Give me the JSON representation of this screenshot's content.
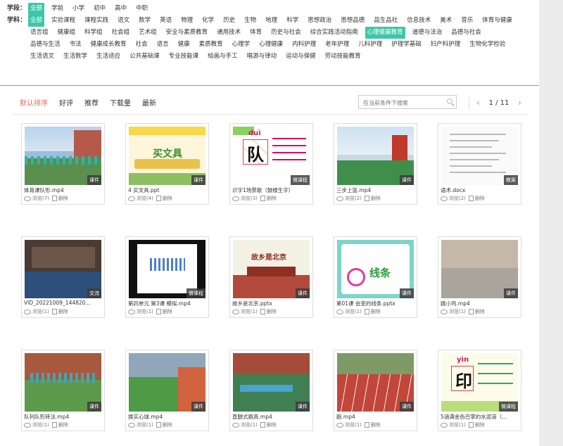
{
  "filters": {
    "stage_label": "学段：",
    "stages": [
      "全部",
      "学前",
      "小学",
      "初中",
      "高中",
      "中职"
    ],
    "stage_active": 0,
    "subject_label": "学科：",
    "subjects": [
      "全部",
      "实验课程",
      "课程实践",
      "语文",
      "数学",
      "英语",
      "物理",
      "化学",
      "历史",
      "生物",
      "地理",
      "科学",
      "思想政治",
      "思想品德",
      "品生品社",
      "信息技术",
      "美术",
      "音乐",
      "体育与健康",
      "语言组",
      "健康组",
      "科学组",
      "社会组",
      "艺术组",
      "安全与素质教育",
      "通用技术",
      "体育",
      "历史与社会",
      "综合实践活动指南",
      "心理健康教育",
      "道德与法治",
      "品德与社会",
      "品德与生活",
      "书法",
      "健康成长教育",
      "社会",
      "语言",
      "健康",
      "素质教育",
      "心理学",
      "心理健康",
      "内科护理",
      "老年护理",
      "儿科护理",
      "护理学基础",
      "妇产科护理",
      "生物化学检验",
      "生活语文",
      "生活数学",
      "生活适应",
      "公共基础课",
      "专业技能课",
      "绘画与手工",
      "唱游与律动",
      "运动与保健",
      "劳动技能教育"
    ],
    "subject_active": [
      0,
      29
    ]
  },
  "sortbar": {
    "sorts": [
      "默认排序",
      "好评",
      "推荐",
      "下载量",
      "最新"
    ],
    "sort_active": 0,
    "search_placeholder": "在当前条件下搜索",
    "page_text": "1 / 11",
    "prev": "‹",
    "next": "›"
  },
  "cards": [
    {
      "title": "体育课队形.mp4",
      "badge": "课件",
      "views": "浏览(7)",
      "del": "删除",
      "thumb": "playground"
    },
    {
      "title": "4 买文具.ppt",
      "badge": "课件",
      "views": "浏览(4)",
      "del": "删除",
      "thumb": "stationery",
      "thumb_text": "买文具"
    },
    {
      "title": "识字1场景歌（鼓楼生字）",
      "badge": "微课程",
      "views": "浏览(3)",
      "del": "删除",
      "thumb": "char",
      "thumb_text": "队",
      "thumb_pinyin": "duì"
    },
    {
      "title": "三步上篮.mp4",
      "badge": "课件",
      "views": "浏览(2)",
      "del": "删除",
      "thumb": "court"
    },
    {
      "title": "语术.docx",
      "badge": "教案",
      "views": "浏览(2)",
      "del": "删除",
      "thumb": "doc"
    },
    {
      "title": "VID_20221009_144820...",
      "badge": "交流",
      "views": "浏览(1)",
      "del": "删除",
      "thumb": "class"
    },
    {
      "title": "第四单元 第3课 模拟.mp4",
      "badge": "微课程",
      "views": "浏览(1)",
      "del": "删除",
      "thumb": "video"
    },
    {
      "title": "故乡是北京.pptx",
      "badge": "课件",
      "views": "浏览(1)",
      "del": "删除",
      "thumb": "beijing",
      "thumb_text": "故乡是北京"
    },
    {
      "title": "第01课 会变的线条.pptx",
      "badge": "课件",
      "views": "浏览(1)",
      "del": "删除",
      "thumb": "lines",
      "thumb_text": "线条"
    },
    {
      "title": "跳小鸡.mp4",
      "badge": "课件",
      "views": "浏览(1)",
      "del": "删除",
      "thumb": "yard"
    },
    {
      "title": "队列队形转法.mp4",
      "badge": "课件",
      "views": "浏览(1)",
      "del": "删除",
      "thumb": "line"
    },
    {
      "title": "换实心球.mp4",
      "badge": "课件",
      "views": "浏览(1)",
      "del": "删除",
      "thumb": "field"
    },
    {
      "title": "直腿式跳高.mp4",
      "badge": "课件",
      "views": "浏览(1)",
      "del": "删除",
      "thumb": "track"
    },
    {
      "title": "跑.mp4",
      "badge": "课件",
      "views": "浏览(1)",
      "del": "删除",
      "thumb": "run"
    },
    {
      "title": "5涵满金色巴掌的水泥道（...",
      "badge": "微课程",
      "views": "浏览(1)",
      "del": "删除",
      "thumb": "char2",
      "thumb_text": "印",
      "thumb_pinyin": "yìn"
    }
  ],
  "colors": {
    "accent": "#3cc8a8",
    "sort_active": "#f06a5a"
  }
}
